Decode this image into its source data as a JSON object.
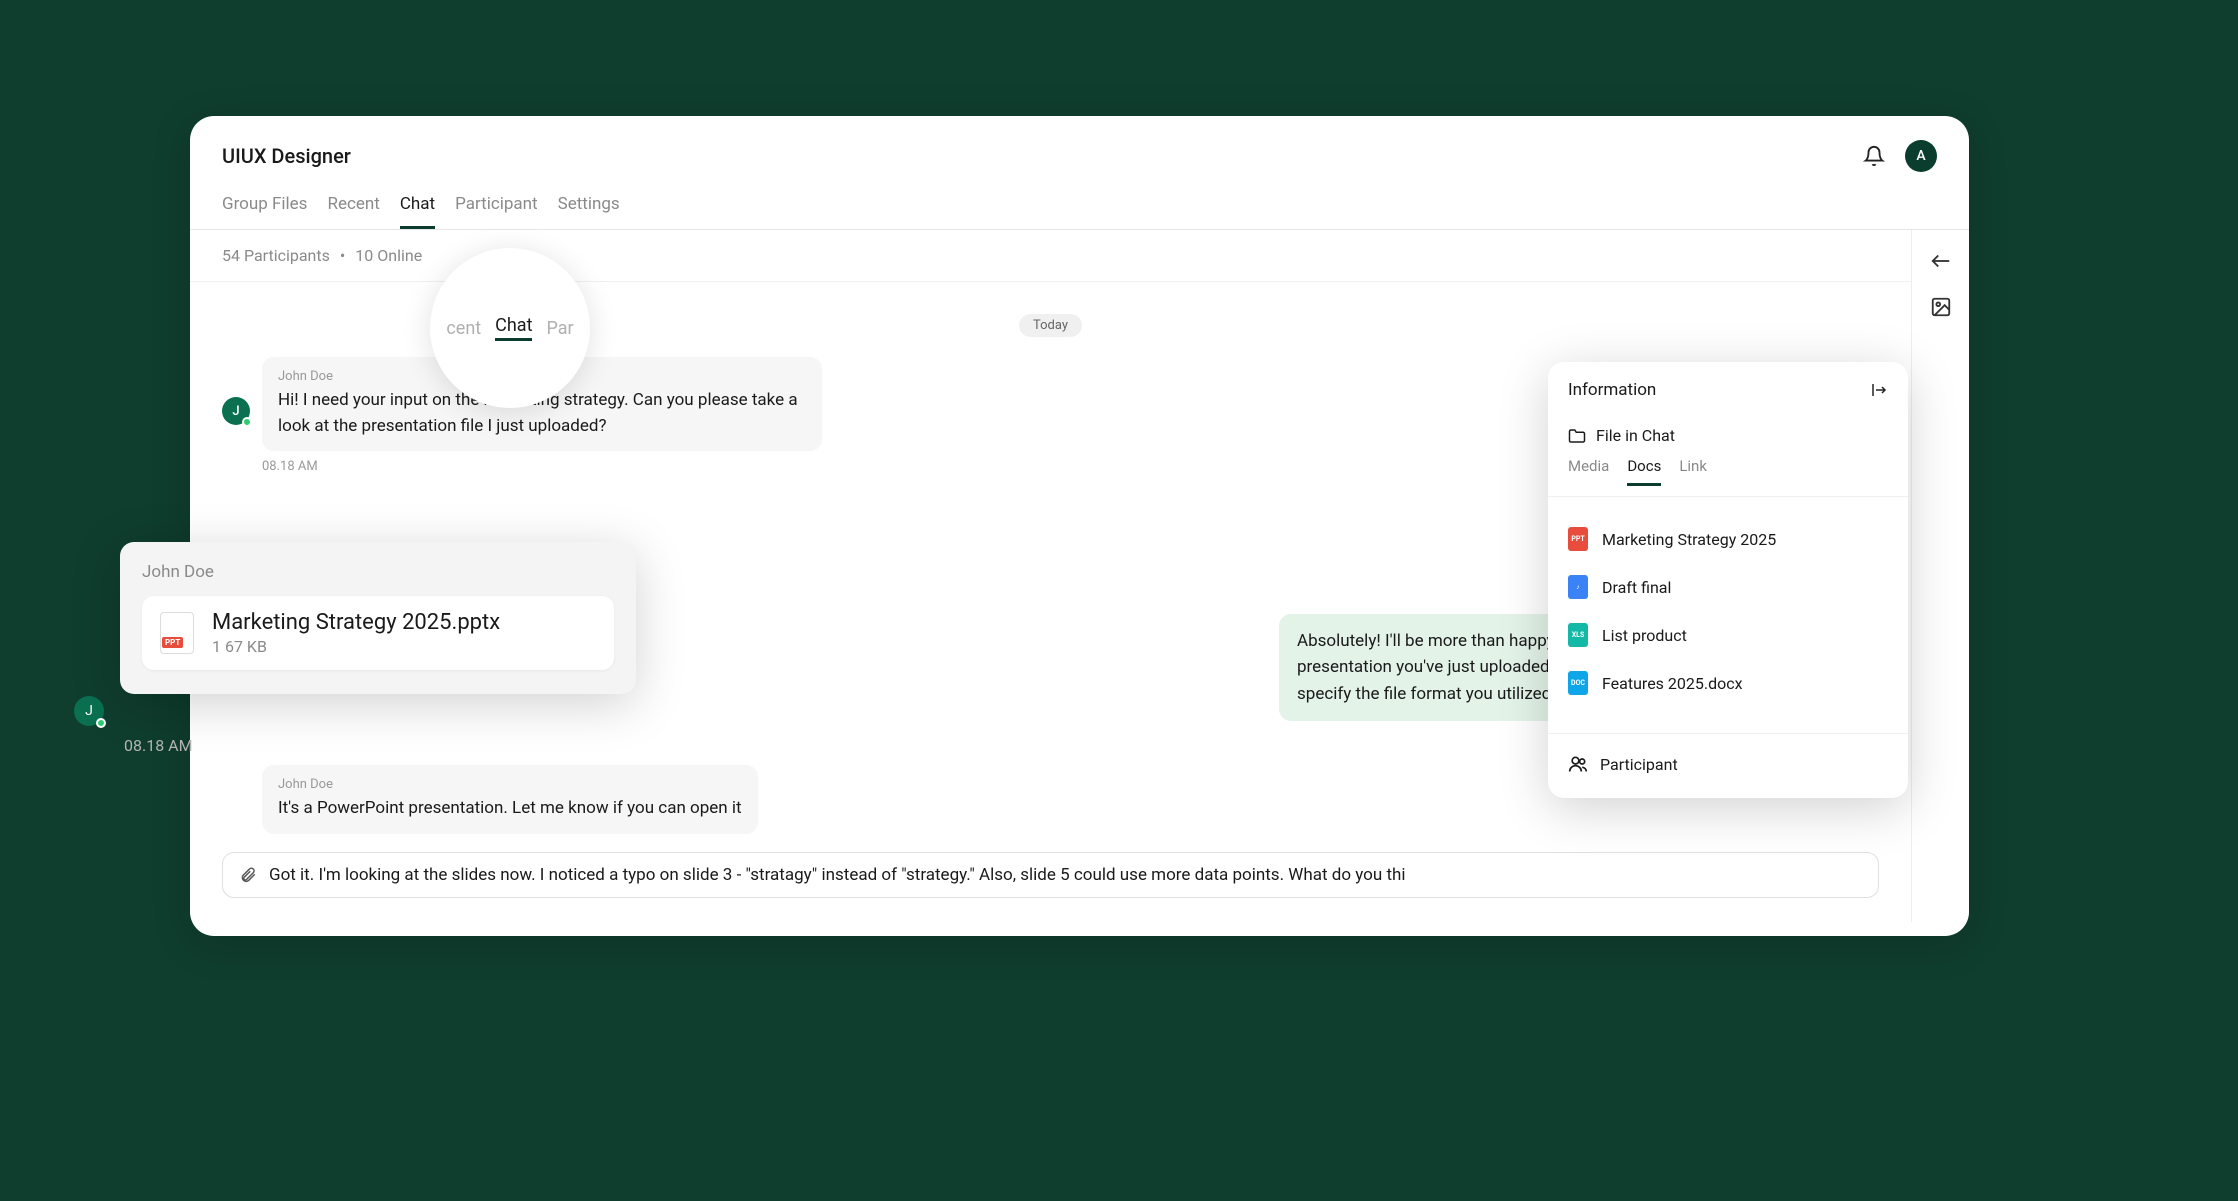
{
  "header": {
    "title": "UIUX Designer",
    "avatar_initial": "A"
  },
  "tabs": [
    "Group Files",
    "Recent",
    "Chat",
    "Participant",
    "Settings"
  ],
  "active_tab": "Chat",
  "zoom": {
    "left": "cent",
    "center": "Chat",
    "right": "Par"
  },
  "status": {
    "participants": "54 Participants",
    "online": "10 Online"
  },
  "date_label": "Today",
  "messages": {
    "m1": {
      "sender": "John Doe",
      "avatar": "J",
      "text": "Hi! I need your input on the marketing strategy. Can you please take a look at the presentation file I just uploaded?",
      "time": "08.18 AM"
    },
    "m2_reply": "Absolutely! I'll be more than happy to review the marketing strategy presentation you've just uploaded. Before I dive into it, could you please specify the file format you utilized for the presentation?",
    "m3": {
      "sender": "John Doe",
      "text": "It's a PowerPoint presentation. Let me know if you can open it"
    }
  },
  "input_value": "Got it. I'm looking at the slides now. I noticed a typo on slide 3 - \"stratagy\" instead of \"strategy.\" Also, slide 5 could use more data points. What do you thi",
  "file_popover": {
    "sender": "John Doe",
    "filename": "Marketing Strategy 2025.pptx",
    "size": "1 67 KB",
    "avatar": "J",
    "time": "08.18 AM"
  },
  "info": {
    "title": "Information",
    "file_section": "File in Chat",
    "sub_tabs": [
      "Media",
      "Docs",
      "Link"
    ],
    "active_sub": "Docs",
    "docs": [
      {
        "name": "Marketing Strategy 2025",
        "type": "ppt"
      },
      {
        "name": "Draft final",
        "type": "media"
      },
      {
        "name": "List product",
        "type": "xls"
      },
      {
        "name": "Features 2025.docx",
        "type": "doc"
      }
    ],
    "participant_label": "Participant"
  }
}
